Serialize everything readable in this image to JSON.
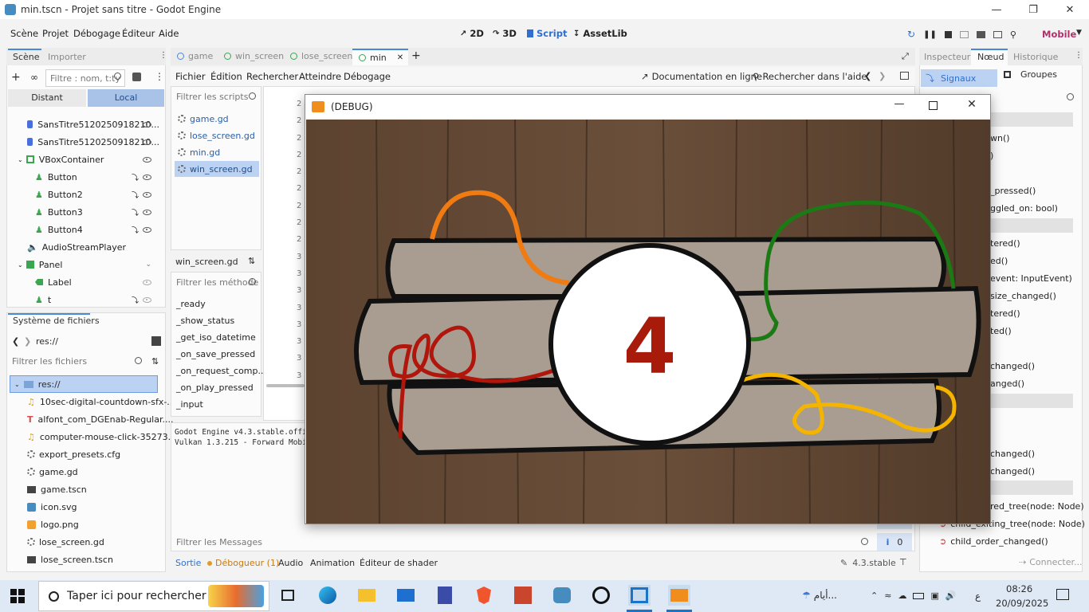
{
  "window": {
    "title": "min.tscn - Projet sans titre - Godot Engine"
  },
  "menu": {
    "items": [
      "Scène",
      "Projet",
      "Débogage",
      "Éditeur",
      "Aide"
    ]
  },
  "modes": {
    "m2d": "2D",
    "m3d": "3D",
    "script": "Script",
    "assetlib": "AssetLib"
  },
  "renderer": "Mobile",
  "scene_dock": {
    "tab_scene": "Scène",
    "tab_import": "Importer",
    "filter_placeholder": "Filtre : nom, t:ty",
    "remote": "Distant",
    "local": "Local",
    "nodes": [
      "SansTitre5120250918210...",
      "SansTitre5120250918210...",
      "VBoxContainer",
      "Button",
      "Button2",
      "Button3",
      "Button4",
      "AudioStreamPlayer",
      "Panel",
      "Label",
      "t"
    ]
  },
  "filesystem": {
    "tab": "Système de fichiers",
    "path": "res://",
    "filter_placeholder": "Filtrer les fichiers",
    "root": "res://",
    "files": [
      "10sec-digital-countdown-sfx-...",
      "alfont_com_DGEnab-Regular....",
      "computer-mouse-click-35273....",
      "export_presets.cfg",
      "game.gd",
      "game.tscn",
      "icon.svg",
      "logo.png",
      "lose_screen.gd",
      "lose_screen.tscn"
    ]
  },
  "scene_tabs": [
    "game",
    "win_screen",
    "lose_screen",
    "min"
  ],
  "script_menu": {
    "items": [
      "Fichier",
      "Édition",
      "Rechercher",
      "Atteindre",
      "Débogage"
    ],
    "online_docs": "Documentation en ligne",
    "search_help": "Rechercher dans l'aide"
  },
  "script_list": {
    "filter_placeholder": "Filtrer les scripts",
    "scripts": [
      "game.gd",
      "lose_screen.gd",
      "min.gd",
      "win_screen.gd"
    ],
    "current": "win_screen.gd",
    "methods_filter": "Filtrer les méthode",
    "methods": [
      "_ready",
      "_show_status",
      "_get_iso_datetime",
      "_on_save_pressed",
      "_on_request_comp...",
      "_on_play_pressed",
      "_input"
    ]
  },
  "line_numbers": [
    "2",
    "2",
    "2",
    "2",
    "2",
    "2",
    "2",
    "2",
    "2",
    "3",
    "3",
    "3",
    "3",
    "3",
    "3",
    "3",
    "3"
  ],
  "output": {
    "lines": [
      "Godot Engine v4.3.stable.offic",
      "Vulkan 1.3.215 - Forward Mobil"
    ],
    "filter": "Filtrer les Messages",
    "bottom_tabs": [
      "Sortie",
      "Débogueur (1)",
      "Audio",
      "Animation",
      "Éditeur de shader"
    ],
    "version": "4.3.stable",
    "counter": "0"
  },
  "inspector": {
    "tabs": [
      "Inspecteur",
      "Nœud",
      "Historique"
    ],
    "signals": "Signaux",
    "groups": "Groupes",
    "signal_items": [
      "wn()",
      ")",
      "_pressed()",
      "ggled_on: bool)",
      "tered()",
      "ed()",
      "event: InputEvent)",
      "size_changed()",
      "tered()",
      "ted()",
      "changed()",
      "anged()",
      "changed()",
      "changed()",
      "red_tree(node: Node)",
      "child_exiting_tree(node: Node)",
      "child_order_changed()"
    ],
    "connect": "Connecter..."
  },
  "game_window": {
    "title": "(DEBUG)",
    "countdown": "4"
  },
  "taskbar": {
    "search_placeholder": "Taper ici pour rechercher",
    "weather": "أيام...",
    "lang": "ع",
    "time": "08:26",
    "date": "20/09/2025"
  },
  "colors": {
    "accent": "#4a88d9",
    "wood": "#5a4030",
    "countdown": "#a81a0a"
  }
}
